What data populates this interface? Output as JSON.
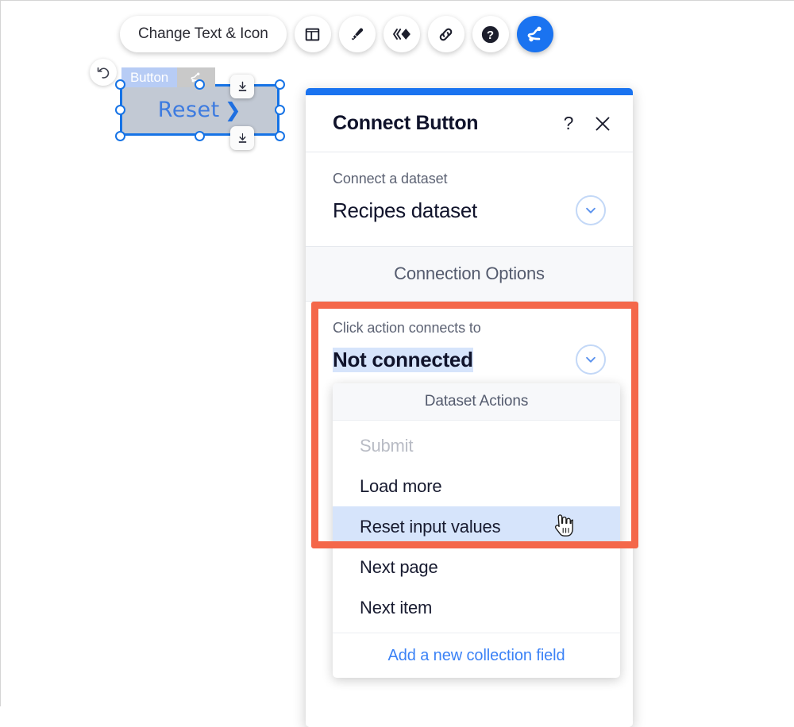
{
  "toolbar": {
    "pill_label": "Change Text & Icon",
    "buttons": [
      {
        "name": "layout-icon",
        "label": "Layout"
      },
      {
        "name": "pen-icon",
        "label": "Design"
      },
      {
        "name": "animation-icon",
        "label": "Animation"
      },
      {
        "name": "link-icon",
        "label": "Link"
      },
      {
        "name": "help-icon",
        "label": "Help"
      },
      {
        "name": "connect-icon",
        "label": "Connect",
        "active": true
      }
    ]
  },
  "canvas": {
    "undo_icon": "undo-icon",
    "widget_tag_name": "Button",
    "widget_tag_icon": "connect-icon",
    "widget_label": "Reset",
    "widget_chevron": "❯",
    "download_badge_icon": "download-icon"
  },
  "dialog": {
    "title": "Connect Button",
    "help_icon": "?",
    "close_icon": "✕",
    "dataset_section": {
      "label": "Connect a dataset",
      "value": "Recipes dataset",
      "chevron_icon": "chevron-down-icon"
    },
    "connection_options_header": "Connection Options",
    "click_action_section": {
      "label": "Click action connects to",
      "value": "Not connected",
      "chevron_icon": "chevron-down-icon"
    },
    "dropdown": {
      "header": "Dataset Actions",
      "items": [
        {
          "label": "Submit",
          "disabled": true,
          "highlighted": false
        },
        {
          "label": "Load more",
          "disabled": false,
          "highlighted": false
        },
        {
          "label": "Reset input values",
          "disabled": false,
          "highlighted": true
        },
        {
          "label": "Next page",
          "disabled": false,
          "highlighted": false
        },
        {
          "label": "Next item",
          "disabled": false,
          "highlighted": false
        }
      ],
      "footer_link": "Add a new collection field"
    }
  },
  "colors": {
    "accent_blue": "#1a73f0",
    "highlight_blue": "#d6e4fb",
    "annotation_red": "#f4674a",
    "link_blue": "#3b82f6"
  }
}
